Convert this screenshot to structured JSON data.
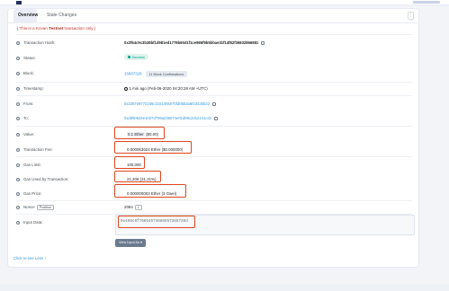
{
  "tabs": [
    {
      "label": "Overview"
    },
    {
      "label": "State Changes"
    }
  ],
  "more_label": "⋮",
  "testnet_notice": {
    "prefix": "[ This is a Kovan ",
    "bold": "Testnet",
    "suffix": " transaction only ]"
  },
  "fields": {
    "tx_hash": {
      "label": "Transaction Hash:",
      "value": "0x2f64c9c3b38bf1d981ed1778b65d1f1ce986f9b5bbae31f14f82f36832866881"
    },
    "status": {
      "label": "Status:",
      "value": "Success"
    },
    "block": {
      "label": "Block:",
      "value": "16987328",
      "confirmations": "11 Block Confirmations"
    },
    "timestamp": {
      "label": "Timestamp:",
      "value": "1 min ago (Feb-06-2020 04:20:28 AM +UTC)"
    },
    "from": {
      "label": "From:",
      "value": "0x2267e8772155c2151405070fd0553a6f2342bb22"
    },
    "to": {
      "label": "To:",
      "value": "0xdd50634e1027d706a235074e01d69c2d12141ccb"
    },
    "value": {
      "label": "Value:",
      "value": "0.1 Ether",
      "usd": "($0.00)"
    },
    "tx_fee": {
      "label": "Transaction Fee:",
      "value": "0.000063624 Ether ($0.000000)"
    },
    "gas_limit": {
      "label": "Gas Limit:",
      "value": "100,000"
    },
    "gas_used": {
      "label": "Gas Used by Transaction:",
      "value": "21,208 (21.21%)"
    },
    "gas_price": {
      "label": "Gas Price:",
      "value": "0.000000003 Ether (3 Gwei)"
    },
    "nonce": {
      "label": "Nonce",
      "position_label": "Position",
      "value": "2084",
      "position": "1"
    },
    "input_data": {
      "label": "Input Data:",
      "value": "0x496c6f76654574686657265736d"
    }
  },
  "view_input_label": "View Input As ▾",
  "see_less_label": "Click to see Less ↑",
  "colors": {
    "accent": "#3498db",
    "success": "#00a186",
    "highlight": "#e0451f",
    "testnet": "#c0392b"
  }
}
